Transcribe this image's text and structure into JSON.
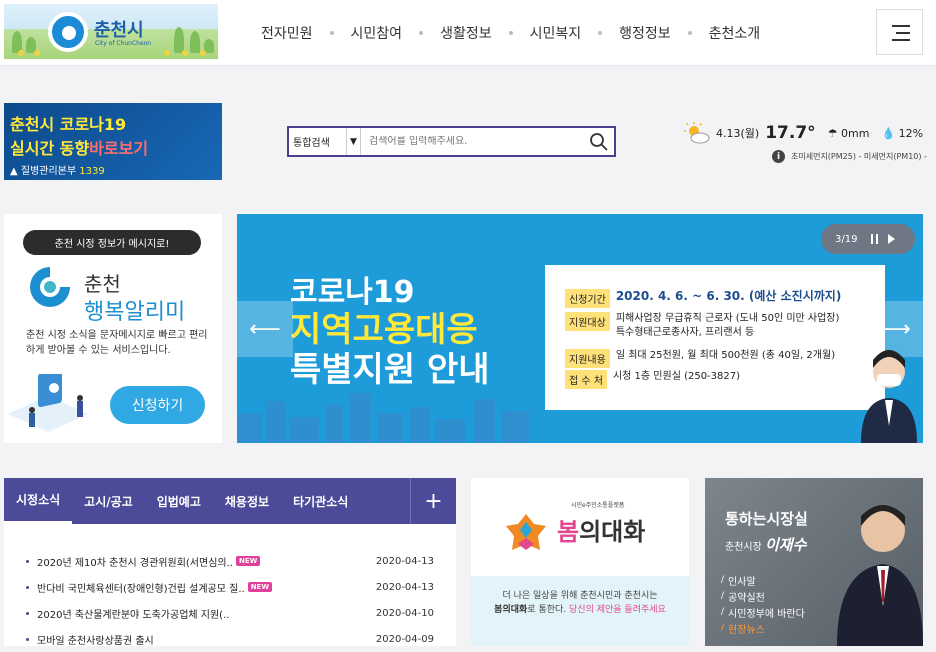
{
  "header": {
    "logo_name": "춘천시",
    "logo_sub": "City of ChunCheon",
    "nav": [
      "전자민원",
      "시민참여",
      "생활정보",
      "시민복지",
      "행정정보",
      "춘천소개"
    ]
  },
  "covid_banner": {
    "line1": "춘천시 코로나19",
    "line2_a": "실시간 동향",
    "line2_b": "바로보기",
    "line3_a": "질병관리본부",
    "line3_b": "1339"
  },
  "search": {
    "scope": "통합검색",
    "placeholder": "검색어를 입력해주세요."
  },
  "weather": {
    "date": "4.13(월)",
    "temp": "17.7°",
    "rain": "0mm",
    "humidity": "12%",
    "dust": "초미세먼지(PM25) - 미세먼지(PM10) -"
  },
  "alarm": {
    "pill": "춘천 시정 정보가 메시지로!",
    "title1": "춘천",
    "title2": "행복알리미",
    "desc": "춘천 시정 소식을 문자메시지로 빠르고 편리하게 받아볼 수 있는 서비스입니다.",
    "apply": "신청하기"
  },
  "banner": {
    "h1": "코로나19",
    "h2": "지역고용대응",
    "h3": "특별지원 안내",
    "rows": [
      {
        "label": "신청기간",
        "value": "2020. 4. 6. ~ 6. 30. (예산 소진시까지)"
      },
      {
        "label": "지원대상",
        "value": "피해사업장 무급휴직 근로자 (도내 50인 미만 사업장)",
        "value2": "특수형태근로종사자, 프리랜서 등"
      },
      {
        "label": "지원내용",
        "value": "일 최대 25천원, 월 최대 500천원 (총 40일, 2개월)"
      },
      {
        "label": "접 수 처",
        "value": "시청 1층 민원실 (250-3827)"
      }
    ],
    "counter": "3/19"
  },
  "notice": {
    "tabs": [
      "시정소식",
      "고시/공고",
      "입법예고",
      "채용정보",
      "타기관소식"
    ],
    "plus": "+",
    "items": [
      {
        "title": "2020년 제10차 춘천시 경관위원회(서면심의..",
        "new": "NEW",
        "date": "2020-04-13"
      },
      {
        "title": "반다비 국민체육센터(장애인형)건립 설계공모 질..",
        "new": "NEW",
        "date": "2020-04-13"
      },
      {
        "title": "2020년 축산물계란분야 도축가공업체 지원(..",
        "new": "",
        "date": "2020-04-10"
      },
      {
        "title": "모바일 춘천사랑상품권 출시",
        "new": "",
        "date": "2020-04-09"
      }
    ]
  },
  "spring": {
    "tag": "시민e주민소통플랫폼",
    "title_a": "봄",
    "title_b": "의대화",
    "p1": "더 나은 일상을 위해 춘천시민과 춘천시는",
    "p2_a": "봄의대화",
    "p2_b": "로 통한다.",
    "p2_c": "당신의 제안을 들려주세요"
  },
  "mayor": {
    "title": "통하는시장실",
    "name_prefix": "춘천시장",
    "name": "이재수",
    "links": [
      "인사말",
      "공약실천",
      "시민정부에 바란다",
      "현장뉴스"
    ]
  }
}
